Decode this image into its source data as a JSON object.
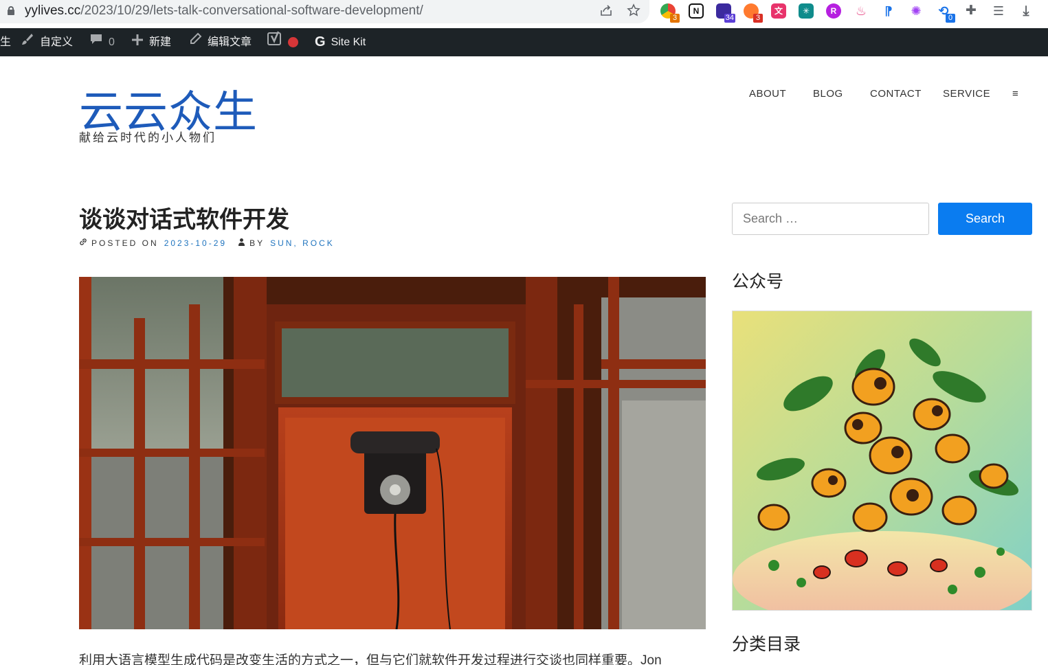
{
  "browser": {
    "url_host": "yylives.cc",
    "url_path": "/2023/10/29/lets-talk-conversational-software-development/",
    "extension_badges": [
      "3",
      "34",
      "3",
      "0"
    ]
  },
  "admin_bar": {
    "truncated_label": "生",
    "customize": "自定义",
    "comments_count": "0",
    "new": "新建",
    "edit_post": "编辑文章",
    "site_kit": "Site Kit"
  },
  "site": {
    "title": "云云众生",
    "description": "献给云时代的小人物们"
  },
  "nav": {
    "items": [
      "ABOUT",
      "BLOG",
      "CONTACT",
      "SERVICE"
    ],
    "menu_glyph": "≡"
  },
  "post": {
    "title": "谈谈对话式软件开发",
    "posted_on_label": "POSTED ON",
    "date": "2023-10-29",
    "by_label": "BY",
    "authors": "SUN, ROCK",
    "excerpt": "利用大语言模型生成代码是改变生活的方式之一，但与它们就软件开发过程进行交谈也同样重要。Jon"
  },
  "sidebar": {
    "search_placeholder": "Search …",
    "search_button": "Search",
    "widget1_title": "公众号",
    "widget2_title": "分类目录"
  },
  "colors": {
    "accent": "#1e5bba",
    "link": "#1e73be",
    "button": "#0a7cf0",
    "admin_bar": "#1d2327"
  }
}
